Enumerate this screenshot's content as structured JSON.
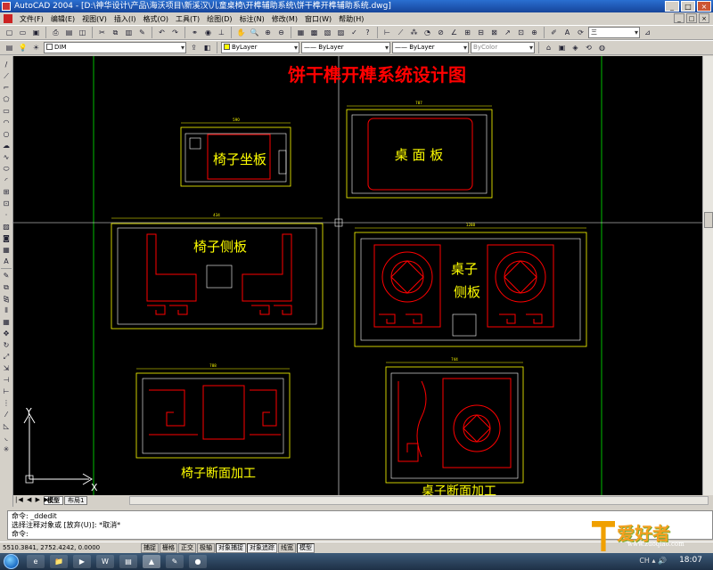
{
  "window": {
    "title": "AutoCAD 2004 - [D:\\神华设计\\产品\\海沃项目\\新溪汉\\儿童桌椅\\开榫辅助系统\\饼干榫开榫辅助系统.dwg]",
    "buttons": [
      "_",
      "□",
      "×"
    ]
  },
  "menubar": {
    "items": [
      "文件(F)",
      "编辑(E)",
      "视图(V)",
      "插入(I)",
      "格式(O)",
      "工具(T)",
      "绘图(D)",
      "标注(N)",
      "修改(M)",
      "窗口(W)",
      "帮助(H)"
    ],
    "mdi_buttons": [
      "_",
      "□",
      "×"
    ]
  },
  "toolbar_standard": {
    "search_value": "三"
  },
  "toolbar_properties": {
    "layer": "DIM",
    "color": "ByLayer",
    "linetype": "—— ByLayer",
    "lineweight": "—— ByLayer",
    "plotstyle": "ByColor"
  },
  "drawing": {
    "title": "饼干榫开榫系统设计图",
    "panels": [
      {
        "label": "椅子坐板",
        "dim_top": "590"
      },
      {
        "label": "桌 面 板",
        "dim_top": "787"
      },
      {
        "label": "椅子侧板",
        "dim_top": "434"
      },
      {
        "label_line1": "桌子",
        "label_line2": "侧板",
        "dim_top": "1288"
      },
      {
        "label": "椅子断面加工",
        "dim_top": "788"
      },
      {
        "label": "桌子断面加工",
        "dim_top": "744"
      }
    ],
    "ucs_x": "X",
    "ucs_y": "Y"
  },
  "tabs": {
    "items": [
      "模型",
      "布局1"
    ],
    "nav": "|◀ ◀ ▶ ▶|"
  },
  "command": {
    "lines": [
      "命令: _ddedit",
      "选择注释对象或 [放弃(U)]: *取消*",
      "命令:"
    ]
  },
  "statusbar": {
    "coords": "5510.3841, 2752.4242, 0.0000",
    "buttons": [
      "捕捉",
      "栅格",
      "正交",
      "极轴",
      "对象捕捉",
      "对象追踪",
      "线宽",
      "模型"
    ]
  },
  "taskbar": {
    "apps": [
      "e",
      "📁",
      "▶",
      "W",
      "▤",
      "▲",
      "✎",
      "●"
    ],
    "tray": "CH ▴ 🔊",
    "clock": "18:07"
  },
  "watermark": {
    "text": "爱好者",
    "url": "www.zuoqiao.com"
  }
}
